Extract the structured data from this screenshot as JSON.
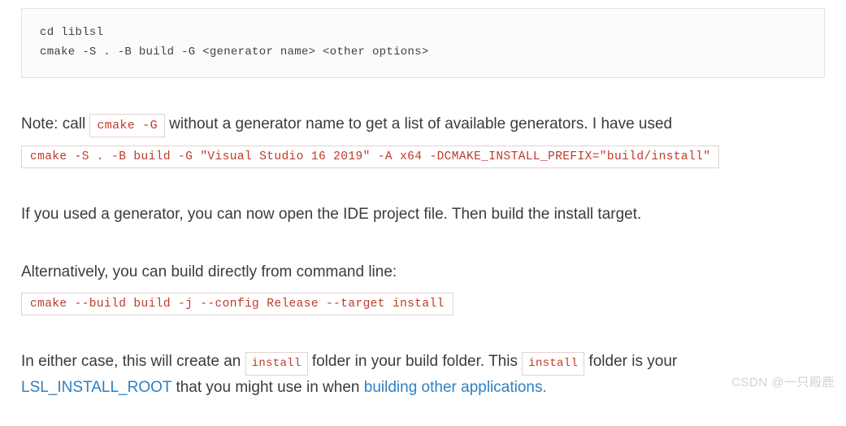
{
  "block1": {
    "line1": "cd liblsl",
    "line2": "cmake -S . -B build -G <generator name> <other options>"
  },
  "para1": {
    "prefix": "Note: call ",
    "code": "cmake -G",
    "suffix": " without a generator name to get a list of available generators. I have used"
  },
  "cmd1": "cmake -S . -B build -G \"Visual Studio 16 2019\" -A x64 -DCMAKE_INSTALL_PREFIX=\"build/install\"",
  "para2": "If you used a generator, you can now open the IDE project file. Then build the install target.",
  "para3": "Alternatively, you can build directly from command line:",
  "cmd2": "cmake --build build -j --config Release --target install",
  "para4": {
    "t1": "In either case, this will create an ",
    "c1": "install",
    "t2": " folder in your build folder. This ",
    "c2": "install",
    "t3": " folder is your ",
    "link1": "LSL_INSTALL_ROOT",
    "t4": " that you might use in when ",
    "link2": "building other applications."
  },
  "watermark": "CSDN @一只殿鹿"
}
